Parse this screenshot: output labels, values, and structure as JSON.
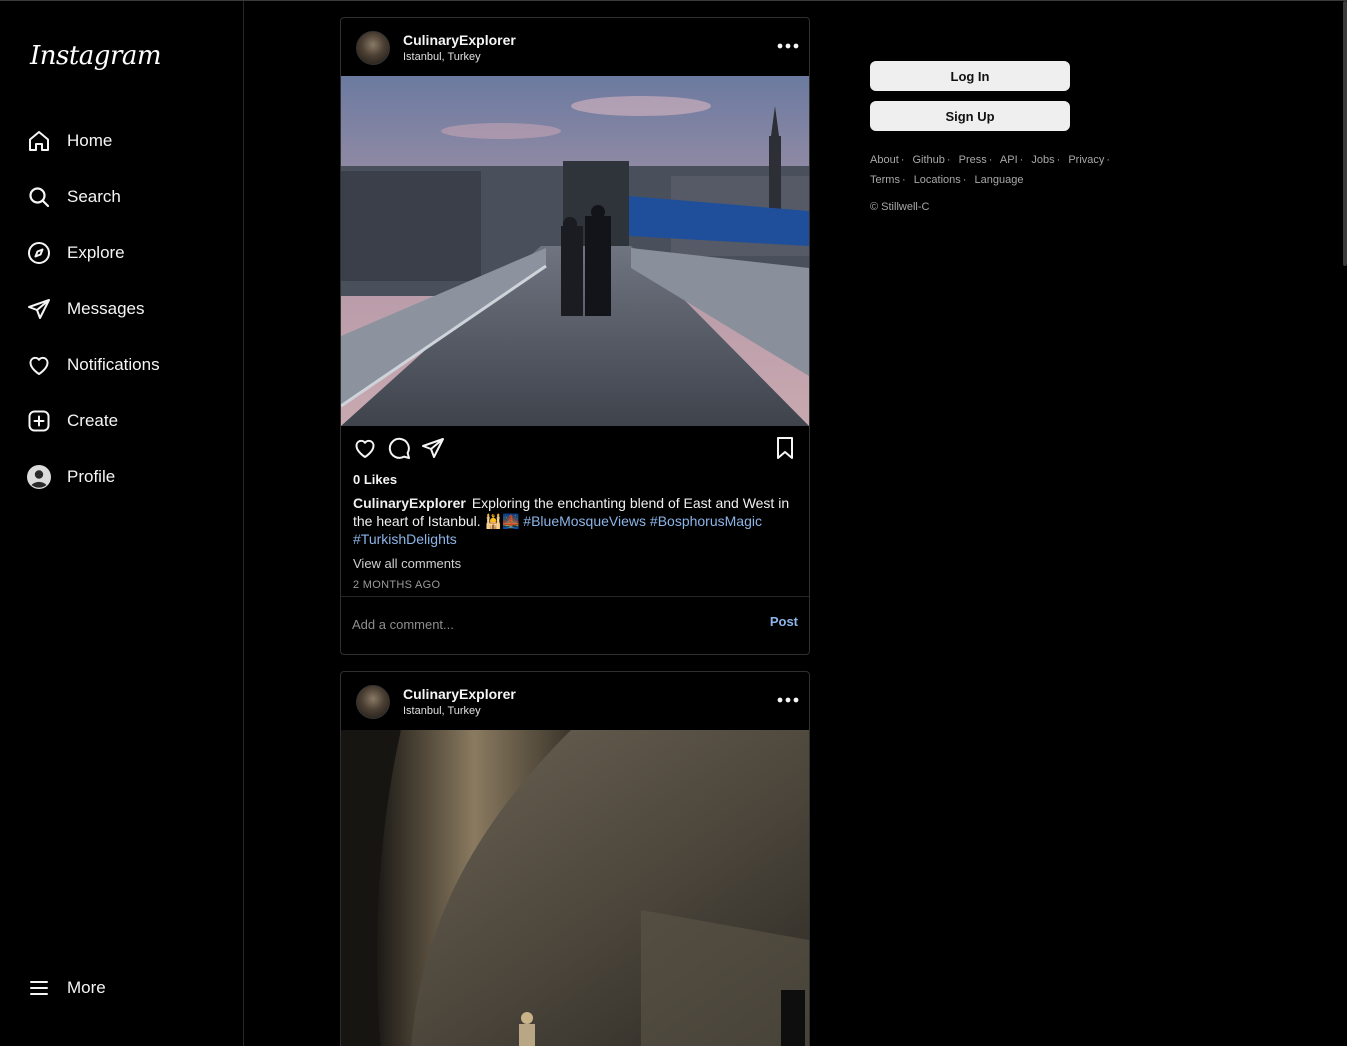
{
  "brand": {
    "logo_text": "Instagram"
  },
  "sidebar": {
    "items": [
      {
        "label": "Home",
        "icon": "home-icon"
      },
      {
        "label": "Search",
        "icon": "search-icon"
      },
      {
        "label": "Explore",
        "icon": "compass-icon"
      },
      {
        "label": "Messages",
        "icon": "send-icon"
      },
      {
        "label": "Notifications",
        "icon": "heart-icon"
      },
      {
        "label": "Create",
        "icon": "plus-square-icon"
      },
      {
        "label": "Profile",
        "icon": "avatar-icon"
      }
    ],
    "more_label": "More"
  },
  "posts": [
    {
      "username": "CulinaryExplorer",
      "location": "Istanbul, Turkey",
      "likes": "0 Likes",
      "caption_user": "CulinaryExplorer",
      "caption_text": "Exploring the enchanting blend of East and West in the heart of Istanbul. 🕌🌉",
      "hashtags": [
        "#BlueMosqueViews",
        "#BosphorusMagic",
        "#TurkishDelights"
      ],
      "view_comments": "View all comments",
      "time_ago": "2 MONTHS AGO",
      "comment_placeholder": "Add a comment...",
      "post_button": "Post"
    },
    {
      "username": "CulinaryExplorer",
      "location": "Istanbul, Turkey"
    }
  ],
  "auth": {
    "login_label": "Log In",
    "signup_label": "Sign Up"
  },
  "footer": {
    "links": [
      "About",
      "Github",
      "Press",
      "API",
      "Jobs",
      "Privacy",
      "Terms",
      "Locations",
      "Language"
    ],
    "copyright": "© Stillwell-C"
  },
  "colors": {
    "background": "#000000",
    "link_blue": "#8cb4e8",
    "button_bg": "#efefef"
  }
}
